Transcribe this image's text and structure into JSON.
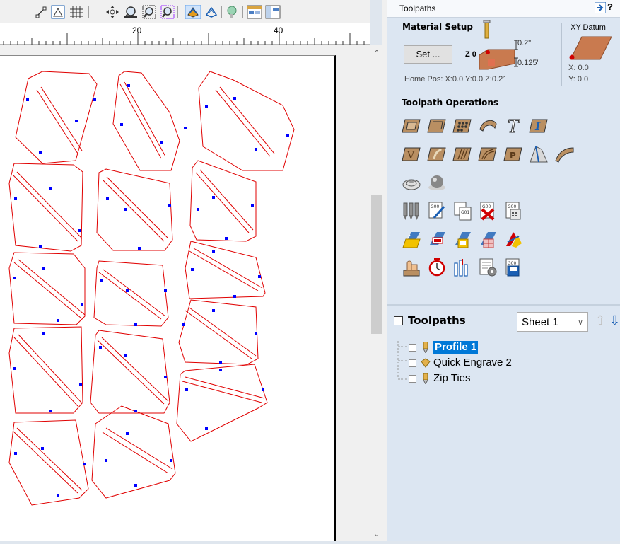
{
  "toolbar": {
    "icons": [
      "select-node-icon",
      "snap-grid-icon",
      "grid-icon",
      "pan-icon",
      "zoom-box-icon",
      "zoom-extents-icon",
      "zoom-selected-icon",
      "toolpath-preview-icon",
      "toolpath-hide-icon",
      "material-icon",
      "layout-icon",
      "panels-icon"
    ]
  },
  "ruler": {
    "labels": [
      "20",
      "40"
    ]
  },
  "panel": {
    "title": "Toolpaths",
    "help": "?",
    "material_setup": {
      "title": "Material Setup",
      "set_button": "Set ...",
      "z0_label": "Z 0",
      "top_dim": "0.2\"",
      "bottom_dim": "0.125\"",
      "home_pos": "Home Pos:  X:0.0 Y:0.0 Z:0.21"
    },
    "xy_datum": {
      "title": "XY Datum",
      "x": "X: 0.0",
      "y": "Y: 0.0"
    },
    "operations_title": "Toolpath Operations",
    "toolpaths_section": {
      "title": "Toolpaths",
      "sheet_select": "Sheet 1",
      "items": [
        {
          "label": "Profile 1",
          "icon": "end-mill-icon",
          "selected": true
        },
        {
          "label": "Quick Engrave 2",
          "icon": "v-bit-icon",
          "selected": false
        },
        {
          "label": "Zip Ties",
          "icon": "end-mill-icon",
          "selected": false
        }
      ]
    }
  },
  "colors": {
    "vector": "#e00000",
    "tab": "#0000ff",
    "selection": "#0078d7",
    "panel_bg": "#dce6f2"
  }
}
